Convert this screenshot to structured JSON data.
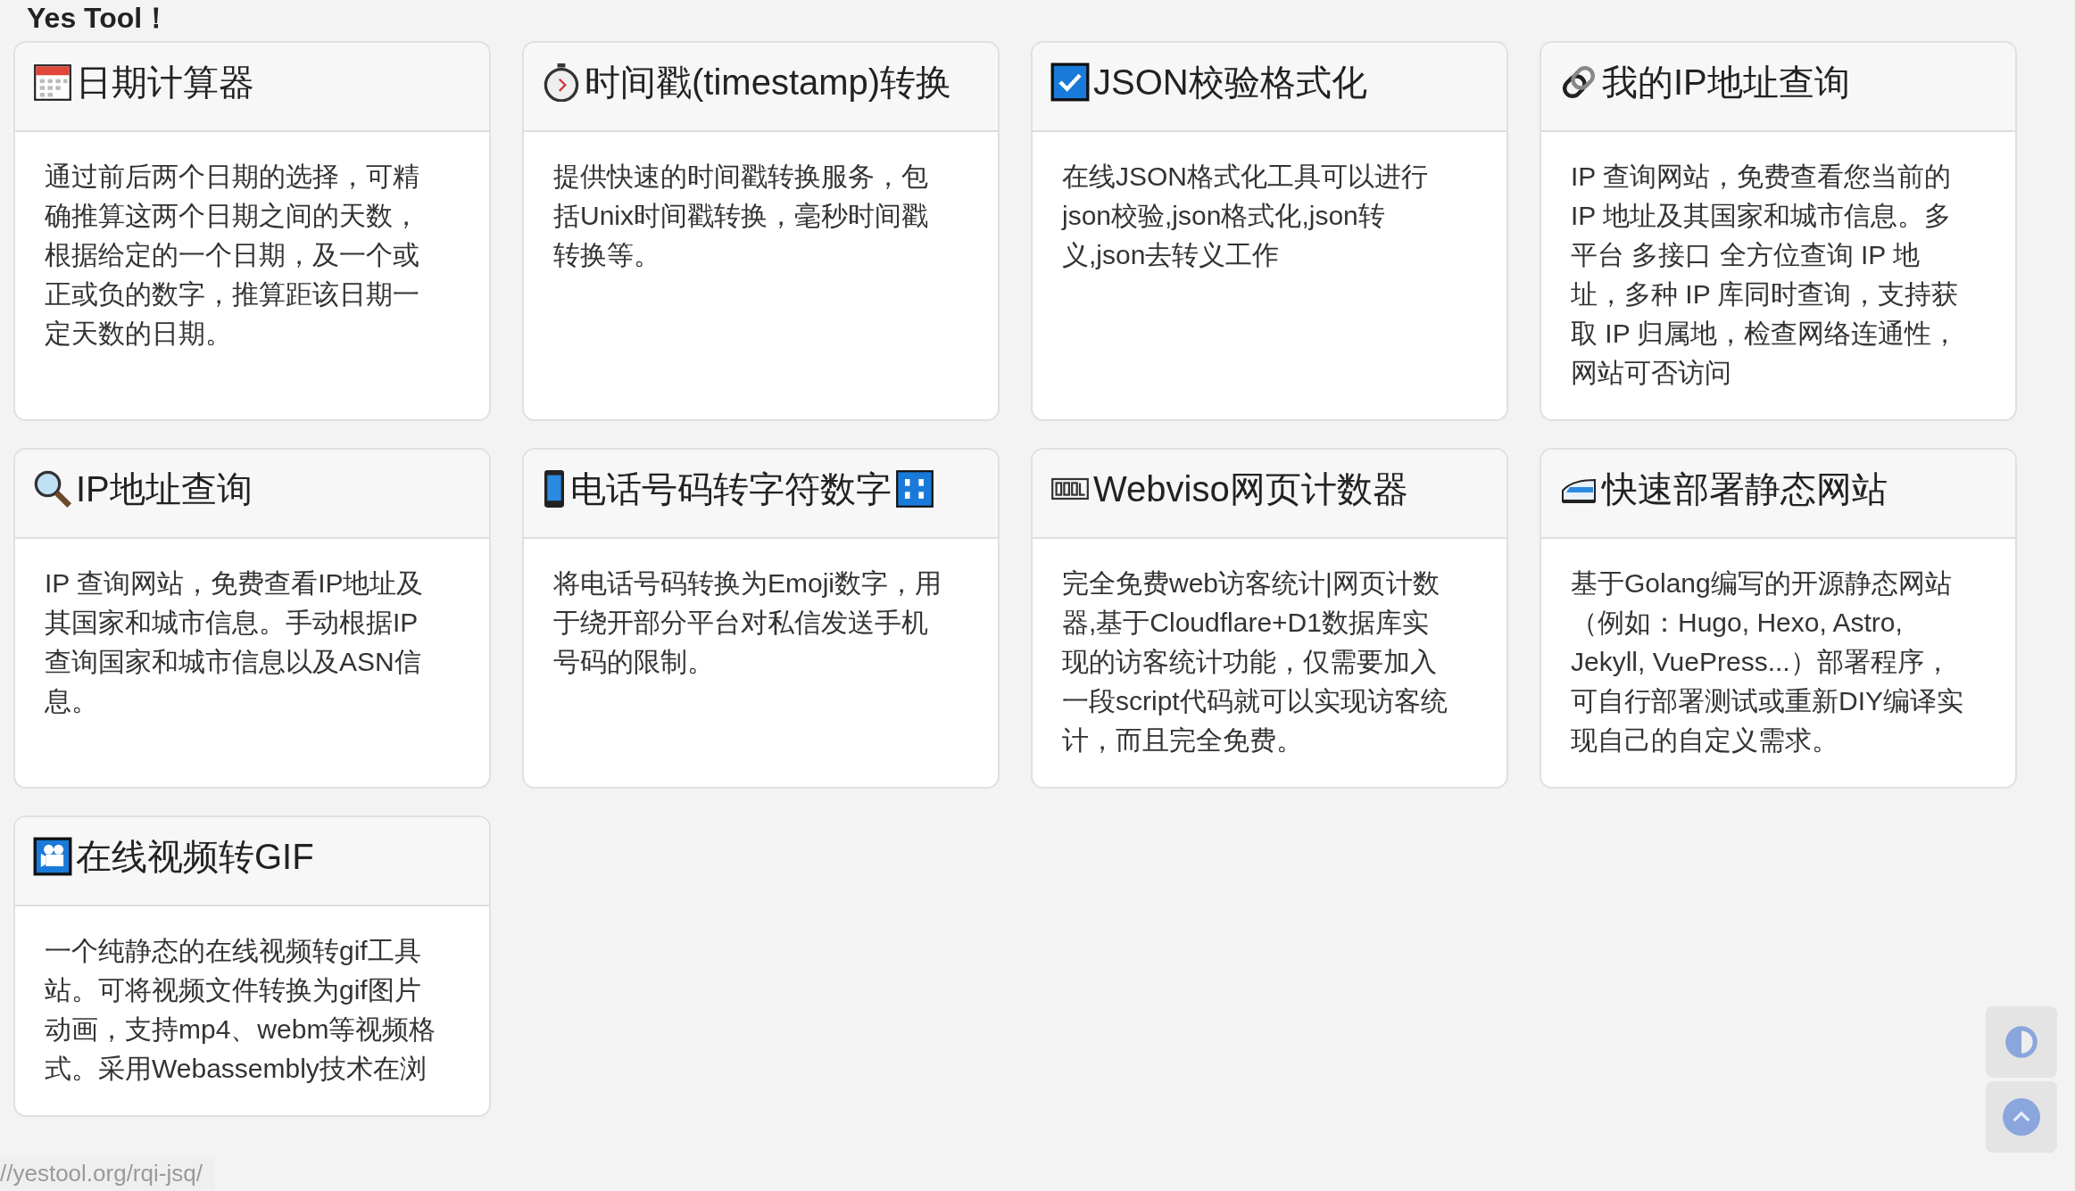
{
  "page_title": "Yes Tool！",
  "tools": [
    {
      "title": "日期计算器",
      "description": "通过前后两个日期的选择，可精确推算这两个日期之间的天数，根据给定的一个日期，及一个或正或负的数字，推算距该日期一定天数的日期。"
    },
    {
      "title": "时间戳(timestamp)转换",
      "description": "提供快速的时间戳转换服务，包括Unix时间戳转换，毫秒时间戳转换等。"
    },
    {
      "title": "JSON校验格式化",
      "description": "在线JSON格式化工具可以进行json校验,json格式化,json转义,json去转义工作"
    },
    {
      "title": "我的IP地址查询",
      "description": "IP 查询网站，免费查看您当前的 IP 地址及其国家和城市信息。多平台 多接口 全方位查询 IP 地址，多种 IP 库同时查询，支持获取 IP 归属地，检查网络连通性，网站可否访问"
    },
    {
      "title": "IP地址查询",
      "description": "IP 查询网站，免费查看IP地址及其国家和城市信息。手动根据IP查询国家和城市信息以及ASN信息。"
    },
    {
      "title": "电话号码转字符数字",
      "description": "将电话号码转换为Emoji数字，用于绕开部分平台对私信发送手机号码的限制。"
    },
    {
      "title": "Webviso网页计数器",
      "description": "完全免费web访客统计|网页计数器,基于Cloudflare+D1数据库实现的访客统计功能，仅需要加入一段script代码就可以实现访客统计，而且完全免费。"
    },
    {
      "title": "快速部署静态网站",
      "description": "基于Golang编写的开源静态网站（例如：Hugo, Hexo, Astro, Jekyll, VuePress...）部署程序，可自行部署测试或重新DIY编译实现自己的自定义需求。"
    },
    {
      "title": "在线视频转GIF",
      "description": "一个纯静态的在线视频转gif工具站。可将视频文件转换为gif图片动画，支持mp4、webm等视频格式。采用Webassembly技术在浏"
    }
  ],
  "status_bar": {
    "link_url": "//yestool.org/rqi-jsq/"
  }
}
